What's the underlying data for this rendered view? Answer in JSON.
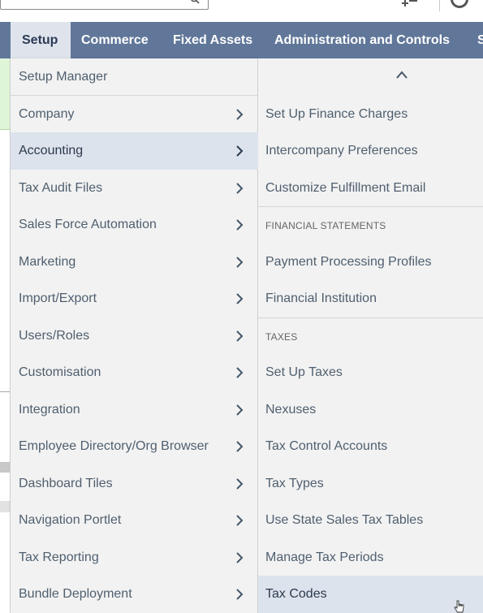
{
  "colors": {
    "navbar_bg": "#607799",
    "nav_active_bg": "#dfe4ec",
    "menu_bg": "#f2f2f2",
    "highlight_bg": "#dde3ed",
    "menu_text": "#4f5f6f"
  },
  "topbar": {
    "search_icon": "search-icon",
    "action_icon": "add-icon",
    "help_icon": "help-icon"
  },
  "navbar": {
    "tabs": [
      {
        "label": "Setup",
        "active": true
      },
      {
        "label": "Commerce"
      },
      {
        "label": "Fixed Assets"
      },
      {
        "label": "Administration and Controls"
      },
      {
        "label": "S"
      }
    ]
  },
  "setup_menu": {
    "items": [
      {
        "label": "Setup Manager",
        "has_submenu": false
      },
      {
        "label": "Company",
        "has_submenu": true
      },
      {
        "label": "Accounting",
        "has_submenu": true,
        "highlighted": true
      },
      {
        "label": "Tax Audit Files",
        "has_submenu": true
      },
      {
        "label": "Sales Force Automation",
        "has_submenu": true
      },
      {
        "label": "Marketing",
        "has_submenu": true
      },
      {
        "label": "Import/Export",
        "has_submenu": true
      },
      {
        "label": "Users/Roles",
        "has_submenu": true
      },
      {
        "label": "Customisation",
        "has_submenu": true
      },
      {
        "label": "Integration",
        "has_submenu": true
      },
      {
        "label": "Employee Directory/Org Browser",
        "has_submenu": true
      },
      {
        "label": "Dashboard Tiles",
        "has_submenu": true
      },
      {
        "label": "Navigation Portlet",
        "has_submenu": true
      },
      {
        "label": "Tax Reporting",
        "has_submenu": true
      },
      {
        "label": "Bundle Deployment",
        "has_submenu": true
      }
    ]
  },
  "accounting_submenu": {
    "scroll_up_icon": "chevron-up-icon",
    "items": [
      {
        "label": "Set Up Finance Charges"
      },
      {
        "label": "Intercompany Preferences"
      },
      {
        "label": "Customize Fulfillment Email"
      },
      {
        "section": "FINANCIAL STATEMENTS"
      },
      {
        "label": "Payment Processing Profiles"
      },
      {
        "label": "Financial Institution"
      },
      {
        "section": "TAXES"
      },
      {
        "label": "Set Up Taxes"
      },
      {
        "label": "Nexuses"
      },
      {
        "label": "Tax Control Accounts"
      },
      {
        "label": "Tax Types"
      },
      {
        "label": "Use State Sales Tax Tables"
      },
      {
        "label": "Manage Tax Periods"
      },
      {
        "label": "Tax Codes",
        "highlighted": true
      }
    ]
  }
}
